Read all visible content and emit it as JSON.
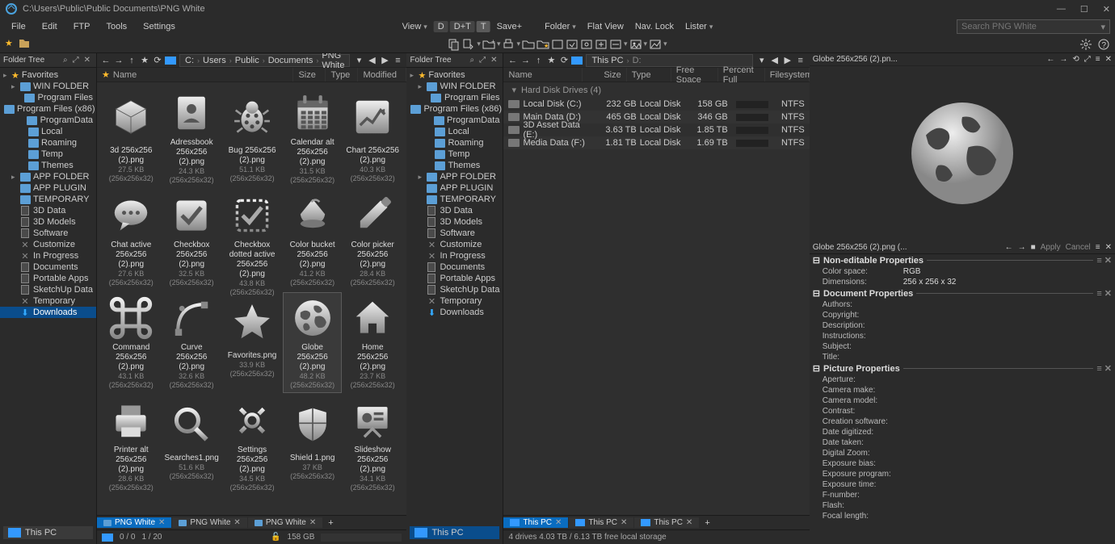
{
  "titlebar": {
    "path": "C:\\Users\\Public\\Public Documents\\PNG White"
  },
  "menu": [
    "File",
    "Edit",
    "FTP",
    "Tools",
    "Settings"
  ],
  "centerToolbar": {
    "view": "View",
    "d": "D",
    "dt": "D+T",
    "t": "T",
    "save": "Save+",
    "folder": "Folder",
    "flat": "Flat View",
    "nav": "Nav. Lock",
    "lister": "Lister"
  },
  "search": {
    "placeholder": "Search PNG White"
  },
  "tree1Title": "Folder Tree",
  "tree2Title": "Folder Tree",
  "favorites": "Favorites",
  "tree": [
    {
      "label": "WIN FOLDER",
      "type": "folder",
      "indent": 1,
      "expandable": true
    },
    {
      "label": "Program Files",
      "type": "folder",
      "indent": 2
    },
    {
      "label": "Program Files (x86)",
      "type": "folder",
      "indent": 2
    },
    {
      "label": "ProgramData",
      "type": "folder",
      "indent": 2
    },
    {
      "label": "Local",
      "type": "folder",
      "indent": 2
    },
    {
      "label": "Roaming",
      "type": "folder",
      "indent": 2
    },
    {
      "label": "Temp",
      "type": "folder",
      "indent": 2
    },
    {
      "label": "Themes",
      "type": "folder",
      "indent": 2
    },
    {
      "label": "APP FOLDER",
      "type": "folder",
      "indent": 1,
      "expandable": true
    },
    {
      "label": "APP PLUGIN",
      "type": "folder",
      "indent": 1
    },
    {
      "label": "TEMPORARY",
      "type": "folder",
      "indent": 1
    },
    {
      "label": "3D Data",
      "type": "doc",
      "indent": 1
    },
    {
      "label": "3D Models",
      "type": "doc",
      "indent": 1
    },
    {
      "label": "Software",
      "type": "doc",
      "indent": 1
    },
    {
      "label": "Customize",
      "type": "x",
      "indent": 1
    },
    {
      "label": "In Progress",
      "type": "x",
      "indent": 1
    },
    {
      "label": "Documents",
      "type": "doc",
      "indent": 1
    },
    {
      "label": "Portable Apps",
      "type": "doc",
      "indent": 1
    },
    {
      "label": "SketchUp Data",
      "type": "doc",
      "indent": 1
    },
    {
      "label": "Temporary",
      "type": "x",
      "indent": 1
    },
    {
      "label": "Downloads",
      "type": "download",
      "indent": 1,
      "selected": true
    }
  ],
  "thisPC": "This PC",
  "breadcrumb1": [
    "C:",
    "Users",
    "Public",
    "Documents",
    "PNG White"
  ],
  "columns": [
    "Name",
    "Size",
    "Type",
    "Modified"
  ],
  "files": [
    {
      "name": "3d 256x256 (2).png",
      "meta": "27.5 KB (256x256x32)",
      "icon": "cube"
    },
    {
      "name": "Adressbook 256x256 (2).png",
      "meta": "24.3 KB (256x256x32)",
      "icon": "addressbook"
    },
    {
      "name": "Bug 256x256 (2).png",
      "meta": "51.1 KB (256x256x32)",
      "icon": "bug"
    },
    {
      "name": "Calendar alt 256x256 (2).png",
      "meta": "31.5 KB (256x256x32)",
      "icon": "calendar"
    },
    {
      "name": "Chart 256x256 (2).png",
      "meta": "40.3 KB (256x256x32)",
      "icon": "chart"
    },
    {
      "name": "Chat active 256x256 (2).png",
      "meta": "27.6 KB (256x256x32)",
      "icon": "chat"
    },
    {
      "name": "Checkbox 256x256 (2).png",
      "meta": "32.5 KB (256x256x32)",
      "icon": "checkbox"
    },
    {
      "name": "Checkbox dotted active 256x256 (2).png",
      "meta": "43.8 KB (256x256x32)",
      "icon": "checkbox-dotted"
    },
    {
      "name": "Color bucket 256x256 (2).png",
      "meta": "41.2 KB (256x256x32)",
      "icon": "bucket"
    },
    {
      "name": "Color picker 256x256 (2).png",
      "meta": "28.4 KB (256x256x32)",
      "icon": "picker"
    },
    {
      "name": "Command 256x256 (2).png",
      "meta": "43.1 KB (256x256x32)",
      "icon": "command"
    },
    {
      "name": "Curve 256x256 (2).png",
      "meta": "32.6 KB (256x256x32)",
      "icon": "curve"
    },
    {
      "name": "Favorites.png",
      "meta": "33.9 KB (256x256x32)",
      "icon": "star"
    },
    {
      "name": "Globe 256x256 (2).png",
      "meta": "48.2 KB (256x256x32)",
      "icon": "globe",
      "selected": true
    },
    {
      "name": "Home 256x256 (2).png",
      "meta": "23.7 KB (256x256x32)",
      "icon": "home"
    },
    {
      "name": "Printer alt 256x256 (2).png",
      "meta": "28.6 KB (256x256x32)",
      "icon": "printer"
    },
    {
      "name": "Searches1.png",
      "meta": "51.6 KB (256x256x32)",
      "icon": "search"
    },
    {
      "name": "Settings 256x256 (2).png",
      "meta": "34.5 KB (256x256x32)",
      "icon": "gear"
    },
    {
      "name": "Shield 1.png",
      "meta": "37 KB (256x256x32)",
      "icon": "shield"
    },
    {
      "name": "Slideshow 256x256 (2).png",
      "meta": "34.1 KB (256x256x32)",
      "icon": "slideshow"
    }
  ],
  "tabs1": [
    {
      "label": "PNG White",
      "active": true
    },
    {
      "label": "PNG White",
      "active": false
    },
    {
      "label": "PNG White",
      "active": false
    }
  ],
  "status1": {
    "count": "0 / 0",
    "selCount": "1 / 20",
    "space": "158 GB"
  },
  "breadcrumb2": [
    "This PC",
    "D:"
  ],
  "columns2": [
    "Name",
    "Size",
    "Type",
    "Free Space",
    "Percent Full",
    "Filesystem"
  ],
  "driveSection": "Hard Disk Drives (4)",
  "drives": [
    {
      "name": "Local Disk (C:)",
      "size": "232 GB",
      "type": "Local Disk",
      "free": "158 GB",
      "pct": 32,
      "fs": "NTFS"
    },
    {
      "name": "Main Data (D:)",
      "size": "465 GB",
      "type": "Local Disk",
      "free": "346 GB",
      "pct": 26,
      "fs": "NTFS"
    },
    {
      "name": "3D Asset Data (E:)",
      "size": "3.63 TB",
      "type": "Local Disk",
      "free": "1.85 TB",
      "pct": 49,
      "fs": "NTFS"
    },
    {
      "name": "Media Data (F:)",
      "size": "1.81 TB",
      "type": "Local Disk",
      "free": "1.69 TB",
      "pct": 7,
      "fs": "NTFS"
    }
  ],
  "tabs2": [
    {
      "label": "This PC",
      "active": true
    },
    {
      "label": "This PC",
      "active": false
    },
    {
      "label": "This PC",
      "active": false
    }
  ],
  "status2": "4 drives   4.03 TB / 6.13 TB free local storage",
  "preview": {
    "title": "Globe 256x256 (2).pn..."
  },
  "propsTitle": "Globe 256x256 (2).png (...",
  "propsButtons": {
    "apply": "Apply",
    "cancel": "Cancel"
  },
  "propSections": [
    {
      "title": "Non-editable Properties",
      "rows": [
        {
          "k": "Color space:",
          "v": "RGB"
        },
        {
          "k": "Dimensions:",
          "v": "256 x 256 x 32"
        }
      ]
    },
    {
      "title": "Document Properties",
      "rows": [
        {
          "k": "Authors:",
          "v": ""
        },
        {
          "k": "Copyright:",
          "v": ""
        },
        {
          "k": "Description:",
          "v": ""
        },
        {
          "k": "Instructions:",
          "v": ""
        },
        {
          "k": "Subject:",
          "v": ""
        },
        {
          "k": "Title:",
          "v": ""
        }
      ]
    },
    {
      "title": "Picture Properties",
      "rows": [
        {
          "k": "Aperture:",
          "v": ""
        },
        {
          "k": "Camera make:",
          "v": ""
        },
        {
          "k": "Camera model:",
          "v": ""
        },
        {
          "k": "Contrast:",
          "v": ""
        },
        {
          "k": "Creation software:",
          "v": ""
        },
        {
          "k": "Date digitized:",
          "v": ""
        },
        {
          "k": "Date taken:",
          "v": ""
        },
        {
          "k": "Digital Zoom:",
          "v": ""
        },
        {
          "k": "Exposure bias:",
          "v": ""
        },
        {
          "k": "Exposure program:",
          "v": ""
        },
        {
          "k": "Exposure time:",
          "v": ""
        },
        {
          "k": "F-number:",
          "v": ""
        },
        {
          "k": "Flash:",
          "v": ""
        },
        {
          "k": "Focal length:",
          "v": ""
        }
      ]
    }
  ]
}
